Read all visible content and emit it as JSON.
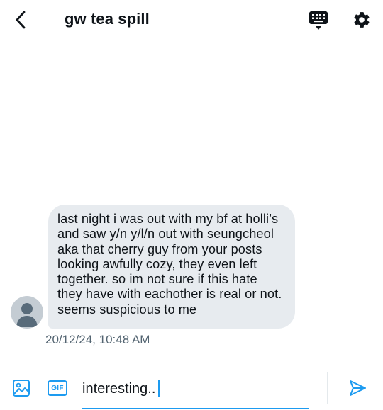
{
  "header": {
    "title": "gw tea spill",
    "back_icon": "chevron-left-icon",
    "keyboard_icon": "keyboard-icon",
    "settings_icon": "gear-icon"
  },
  "message": {
    "text": "last night i was out with my bf at holli’s and saw y/n y/l/n out with seungcheol aka that cherry guy from your posts looking awfully cozy, they even left together. so im not sure if this hate they have with eachother is real or not. seems suspicious to me",
    "timestamp": "20/12/24, 10:48 AM",
    "avatar_icon": "default-avatar-icon"
  },
  "composer": {
    "value": "interesting..",
    "image_icon": "image-icon",
    "gif_label": "GIF",
    "send_icon": "send-icon"
  },
  "colors": {
    "accent": "#1d9bf0",
    "bubble": "#e7ebef",
    "text": "#0f1419",
    "muted": "#536471"
  }
}
